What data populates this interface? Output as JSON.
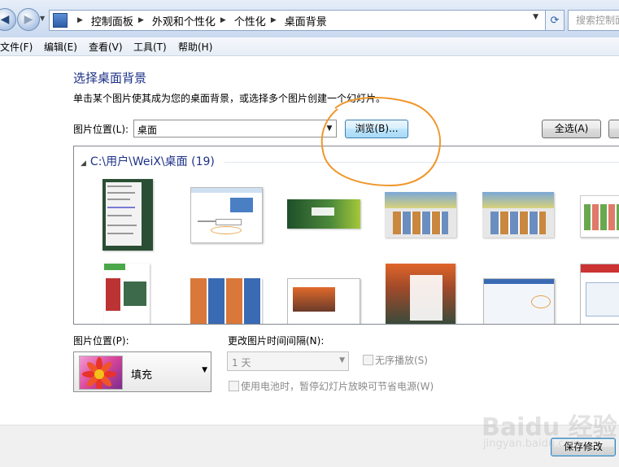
{
  "address_bar": {
    "crumbs": [
      "控制面板",
      "外观和个性化",
      "个性化",
      "桌面背景"
    ],
    "search_placeholder": "搜索控制面板"
  },
  "menu": [
    "文件(F)",
    "编辑(E)",
    "查看(V)",
    "工具(T)",
    "帮助(H)"
  ],
  "page": {
    "title": "选择桌面背景",
    "description": "单击某个图片使其成为您的桌面背景，或选择多个图片创建一个幻灯片。"
  },
  "location": {
    "label": "图片位置(L):",
    "value": "桌面",
    "browse_label": "浏览(B)...",
    "select_all_label": "全选(A)"
  },
  "gallery": {
    "group_title": "C:\\用户\\WeiX\\桌面 (19)"
  },
  "position": {
    "label": "图片位置(P):",
    "value": "填充"
  },
  "interval": {
    "label": "更改图片时间间隔(N):",
    "value": "1 天",
    "shuffle_label": "无序播放(S)",
    "battery_label": "使用电池时，暂停幻灯片放映可节省电源(W)"
  },
  "footer": {
    "save_label": "保存修改"
  },
  "watermark": {
    "text": "Baidu 经验",
    "sub": "jingyan.baidu.com"
  },
  "colors": {
    "heading": "#1e3287",
    "annotation": "#f0962a"
  }
}
